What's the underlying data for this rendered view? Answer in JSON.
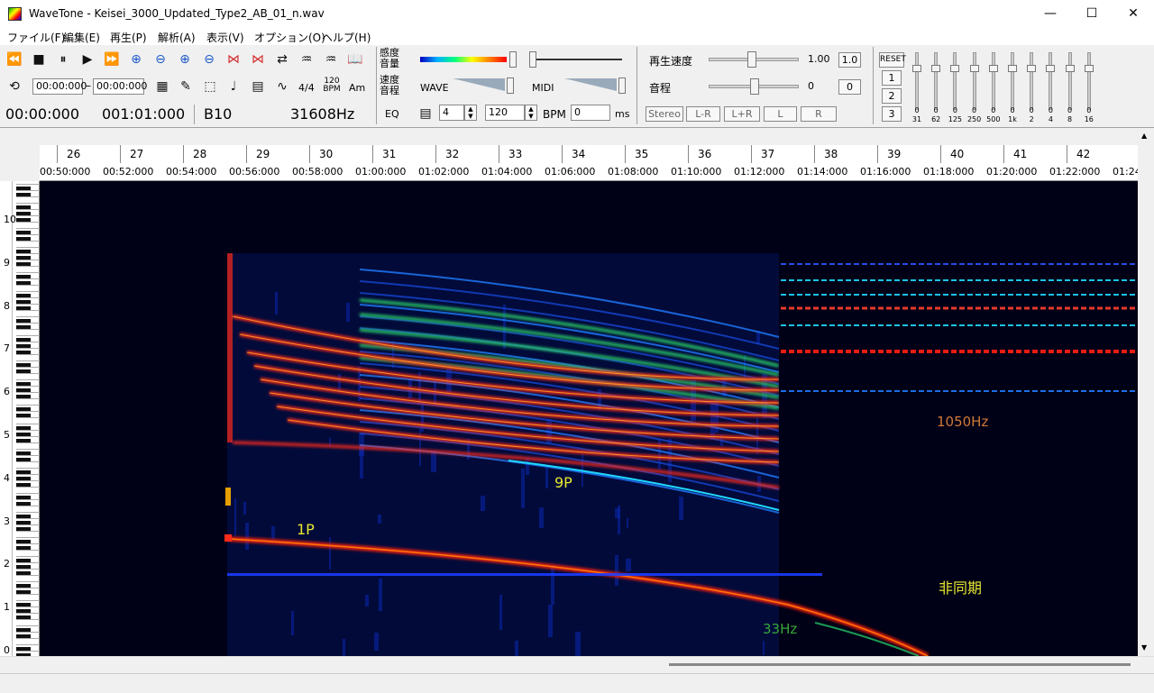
{
  "window": {
    "title": "WaveTone - Keisei_3000_Updated_Type2_AB_01_n.wav",
    "minimize": "—",
    "maximize": "☐",
    "close": "✕"
  },
  "menu": [
    "ファイル(F)",
    "編集(E)",
    "再生(P)",
    "解析(A)",
    "表示(V)",
    "オプション(O)",
    "ヘルプ(H)"
  ],
  "toolbar": {
    "loop_start": "00:00:000",
    "loop_end": "00:00:000",
    "dash": "–",
    "time_sig": "4/4",
    "bpm_icon": "120 BPM",
    "am": "Am",
    "position_time": "00:00:000",
    "position_measure": "001:01:000",
    "note": "B10",
    "frequency": "31608Hz",
    "eq_label": "EQ",
    "sensitivity_label": "感度\n音量",
    "speed_pitch_label": "速度\n音程",
    "wave_label": "WAVE",
    "midi_label": "MIDI",
    "beats_value": "4",
    "bpm_value": "120",
    "bpm_unit": "BPM",
    "ms_value": "0",
    "ms_unit": "ms",
    "playback_speed_label": "再生速度",
    "playback_speed_value": "1.00",
    "playback_speed_reset": "1.0",
    "pitch_label": "音程",
    "pitch_value": "0",
    "pitch_reset": "0",
    "channel_buttons": [
      "Stereo",
      "L-R",
      "L+R",
      "L",
      "R"
    ],
    "eq_reset": "RESET",
    "eq_presets": [
      "1",
      "2",
      "3"
    ],
    "eq_bands": [
      {
        "value": "0",
        "freq": "31"
      },
      {
        "value": "0",
        "freq": "62"
      },
      {
        "value": "0",
        "freq": "125"
      },
      {
        "value": "0",
        "freq": "250"
      },
      {
        "value": "0",
        "freq": "500"
      },
      {
        "value": "0",
        "freq": "1k"
      },
      {
        "value": "0",
        "freq": "2"
      },
      {
        "value": "0",
        "freq": "4"
      },
      {
        "value": "0",
        "freq": "8"
      },
      {
        "value": "0",
        "freq": "16"
      }
    ]
  },
  "ruler": {
    "beats": [
      "26",
      "27",
      "28",
      "29",
      "30",
      "31",
      "32",
      "33",
      "34",
      "35",
      "36",
      "37",
      "38",
      "39",
      "40",
      "41",
      "42"
    ],
    "times": [
      "00:50:000",
      "00:52:000",
      "00:54:000",
      "00:56:000",
      "00:58:000",
      "01:00:000",
      "01:02:000",
      "01:04:000",
      "01:06:000",
      "01:08:000",
      "01:10:000",
      "01:12:000",
      "01:14:000",
      "01:16:000",
      "01:18:000",
      "01:20:000",
      "01:22:000",
      "01:24"
    ]
  },
  "octaves": [
    "10",
    "9",
    "8",
    "7",
    "6",
    "5",
    "4",
    "3",
    "2",
    "1",
    "0"
  ],
  "annotations": {
    "p1": "1P",
    "p9": "9P",
    "hz1050": "1050Hz",
    "async": "非同期",
    "hz33": "33Hz"
  },
  "colors": {
    "annot_yellow": "#e8e830",
    "annot_orange": "#d07838",
    "annot_green": "#38a838",
    "background": "#000016"
  }
}
